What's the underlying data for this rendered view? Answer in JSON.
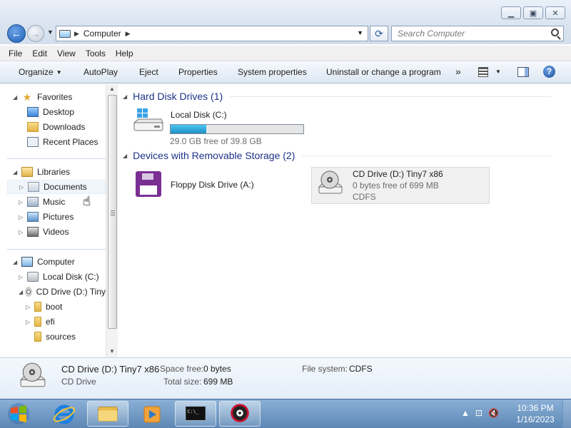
{
  "window": {
    "controls": [
      "minimize",
      "maximize",
      "close"
    ]
  },
  "address": {
    "path": "Computer",
    "search_placeholder": "Search Computer"
  },
  "menu": [
    "File",
    "Edit",
    "View",
    "Tools",
    "Help"
  ],
  "toolbar": {
    "organize": "Organize",
    "autoplay": "AutoPlay",
    "eject": "Eject",
    "properties": "Properties",
    "system_properties": "System properties",
    "uninstall": "Uninstall or change a program",
    "more": "»"
  },
  "nav": {
    "favorites": "Favorites",
    "favorites_items": [
      "Desktop",
      "Downloads",
      "Recent Places"
    ],
    "libraries": "Libraries",
    "library_items": [
      "Documents",
      "Music",
      "Pictures",
      "Videos"
    ],
    "computer": "Computer",
    "computer_items": [
      "Local Disk (C:)",
      "CD Drive (D:) Tiny"
    ],
    "cd_children": [
      "boot",
      "efi",
      "sources"
    ]
  },
  "content": {
    "hdd_group": "Hard Disk Drives (1)",
    "local_disk": {
      "name": "Local Disk (C:)",
      "free": "29.0 GB free of 39.8 GB",
      "used_fraction": 0.27
    },
    "removable_group": "Devices with Removable Storage (2)",
    "floppy": {
      "name": "Floppy Disk Drive (A:)"
    },
    "cd": {
      "name": "CD Drive (D:) Tiny7 x86",
      "free": "0 bytes free of 699 MB",
      "fs": "CDFS"
    }
  },
  "details": {
    "name": "CD Drive (D:) Tiny7 x86",
    "type": "CD Drive",
    "space_free_label": "Space free:",
    "space_free": "0 bytes",
    "total_size_label": "Total size:",
    "total_size": "699 MB",
    "fs_label": "File system:",
    "fs": "CDFS"
  },
  "taskbar": {
    "time": "10:36 PM",
    "date": "1/16/2023"
  },
  "colors": {
    "group_header": "#1e3287",
    "disk_bar": "#2aa6da",
    "taskbar": "#6f97c2"
  }
}
